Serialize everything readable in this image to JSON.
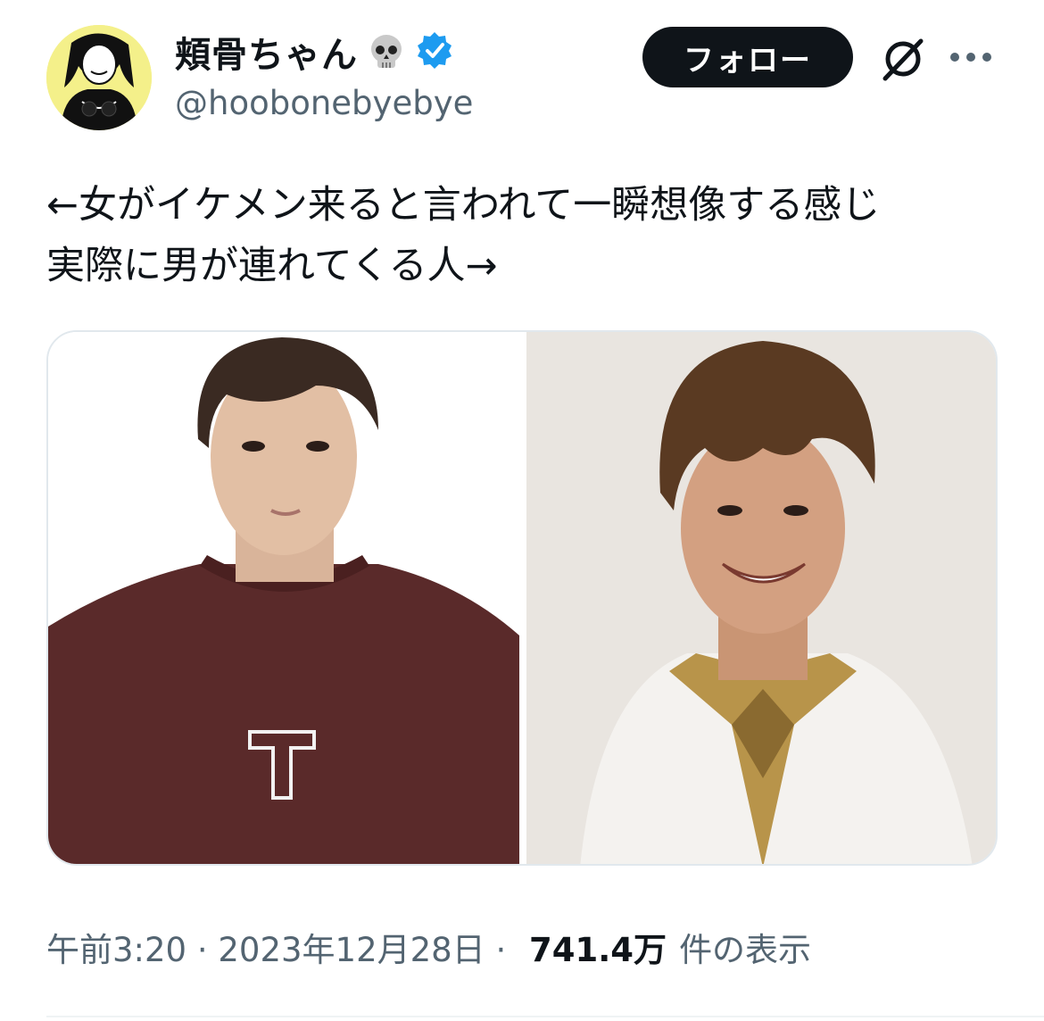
{
  "author": {
    "display_name": "頬骨ちゃん",
    "handle": "@hoobonebyebye",
    "verified": true,
    "name_emoji": "skull-icon",
    "avatar_bg": "#f4f08a"
  },
  "actions": {
    "follow_label": "フォロー",
    "grok_icon": "grok-icon",
    "more_icon": "more-icon"
  },
  "tweet": {
    "text": "←女がイケメン来ると言われて一瞬想像する感じ\n実際に男が連れてくる人→"
  },
  "media": {
    "images": [
      {
        "name": "photo-left",
        "shirt_letter": "T"
      },
      {
        "name": "photo-right"
      }
    ]
  },
  "meta": {
    "time": "午前3:20",
    "sep1": " · ",
    "date": "2023年12月28日",
    "sep2": " · ",
    "views_count": "741.4万",
    "views_label": "件の表示"
  },
  "colors": {
    "text": "#0f1419",
    "secondary": "#536471",
    "verified": "#1d9bf0",
    "follow_bg": "#0f1419"
  }
}
